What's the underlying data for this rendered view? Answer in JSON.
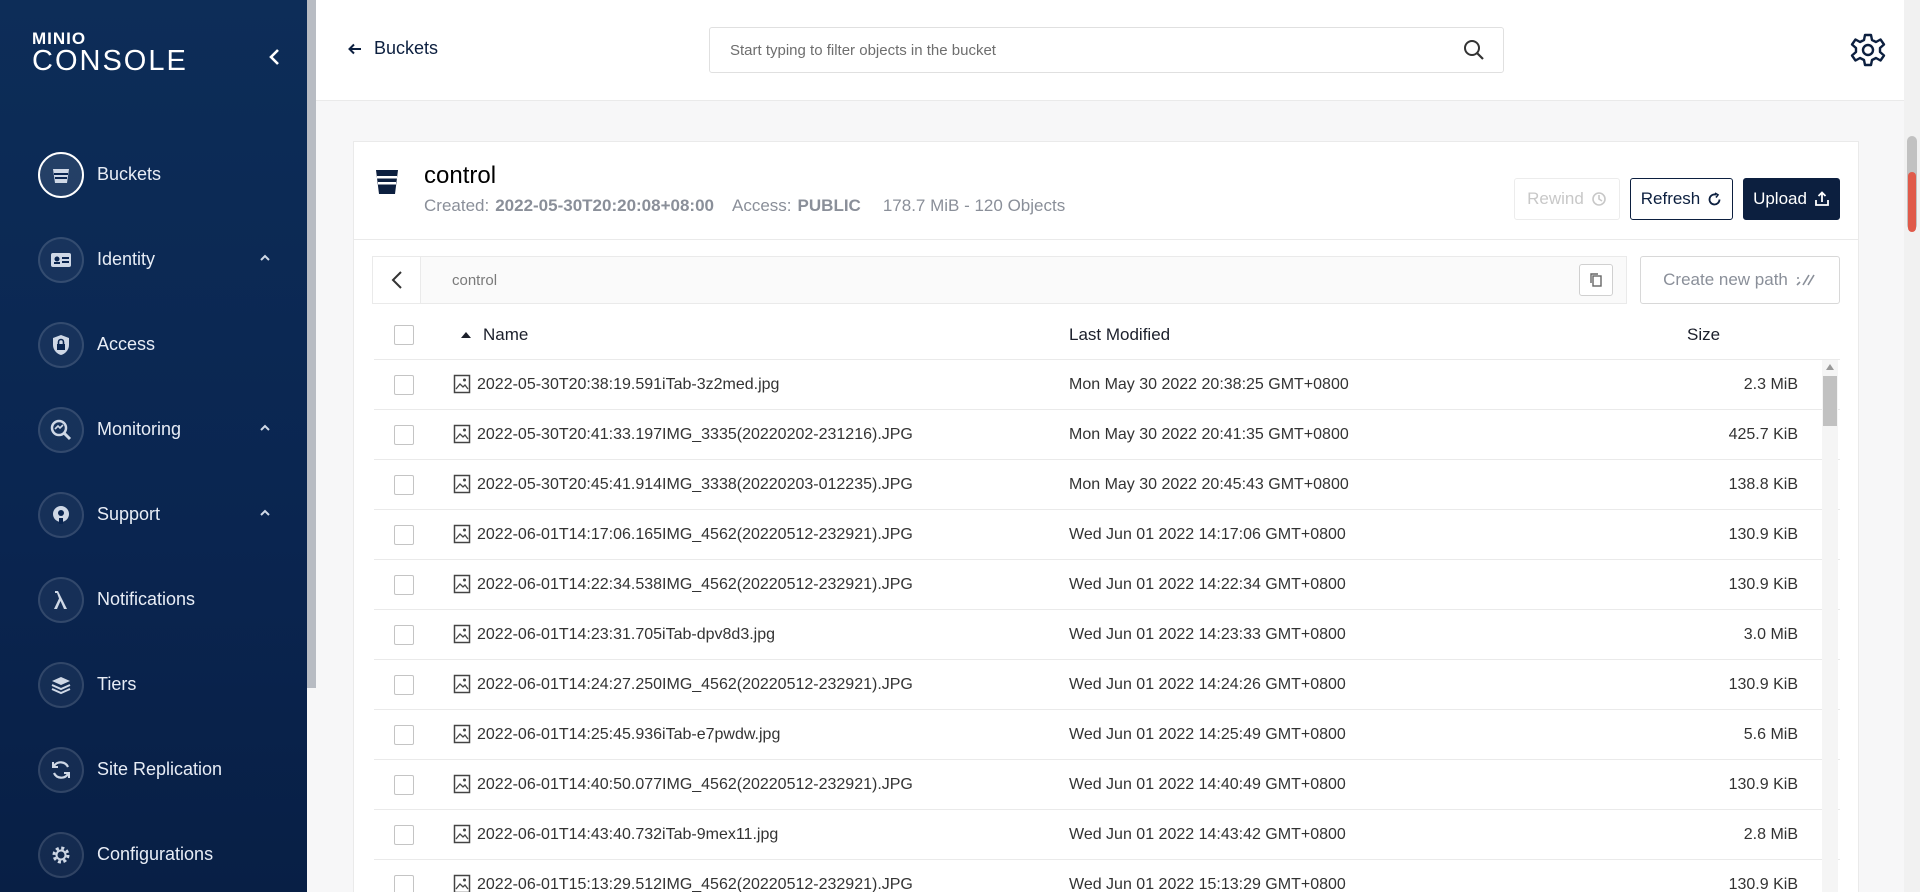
{
  "sidebar": {
    "brand": "MINIO",
    "product": "CONSOLE",
    "items": [
      {
        "label": "Buckets",
        "icon": "bucket-icon",
        "active": true
      },
      {
        "label": "Identity",
        "icon": "id-card-icon",
        "expandable": true
      },
      {
        "label": "Access",
        "icon": "lock-shield-icon"
      },
      {
        "label": "Monitoring",
        "icon": "magnifier-chart-icon",
        "expandable": true
      },
      {
        "label": "Support",
        "icon": "support-icon",
        "expandable": true
      },
      {
        "label": "Notifications",
        "icon": "lambda-icon"
      },
      {
        "label": "Tiers",
        "icon": "layers-icon"
      },
      {
        "label": "Site Replication",
        "icon": "sync-icon"
      },
      {
        "label": "Configurations",
        "icon": "gear-icon"
      }
    ]
  },
  "header": {
    "back_label": "Buckets",
    "search_placeholder": "Start typing to filter objects in the bucket"
  },
  "bucket": {
    "name": "control",
    "created_label": "Created:",
    "created_value": "2022-05-30T20:20:08+08:00",
    "access_label": "Access:",
    "access_value": "PUBLIC",
    "size_summary": "178.7 MiB - 120 Objects",
    "rewind_label": "Rewind",
    "refresh_label": "Refresh",
    "upload_label": "Upload"
  },
  "breadcrumb": {
    "path": "control",
    "new_path_label": "Create new path"
  },
  "table": {
    "columns": {
      "name": "Name",
      "modified": "Last Modified",
      "size": "Size"
    },
    "rows": [
      {
        "name": "2022-05-30T20:38:19.591iTab-3z2med.jpg",
        "modified": "Mon May 30 2022 20:38:25 GMT+0800",
        "size": "2.3 MiB"
      },
      {
        "name": "2022-05-30T20:41:33.197IMG_3335(20220202-231216).JPG",
        "modified": "Mon May 30 2022 20:41:35 GMT+0800",
        "size": "425.7 KiB"
      },
      {
        "name": "2022-05-30T20:45:41.914IMG_3338(20220203-012235).JPG",
        "modified": "Mon May 30 2022 20:45:43 GMT+0800",
        "size": "138.8 KiB"
      },
      {
        "name": "2022-06-01T14:17:06.165IMG_4562(20220512-232921).JPG",
        "modified": "Wed Jun 01 2022 14:17:06 GMT+0800",
        "size": "130.9 KiB"
      },
      {
        "name": "2022-06-01T14:22:34.538IMG_4562(20220512-232921).JPG",
        "modified": "Wed Jun 01 2022 14:22:34 GMT+0800",
        "size": "130.9 KiB"
      },
      {
        "name": "2022-06-01T14:23:31.705iTab-dpv8d3.jpg",
        "modified": "Wed Jun 01 2022 14:23:33 GMT+0800",
        "size": "3.0 MiB"
      },
      {
        "name": "2022-06-01T14:24:27.250IMG_4562(20220512-232921).JPG",
        "modified": "Wed Jun 01 2022 14:24:26 GMT+0800",
        "size": "130.9 KiB"
      },
      {
        "name": "2022-06-01T14:25:45.936iTab-e7pwdw.jpg",
        "modified": "Wed Jun 01 2022 14:25:49 GMT+0800",
        "size": "5.6 MiB"
      },
      {
        "name": "2022-06-01T14:40:50.077IMG_4562(20220512-232921).JPG",
        "modified": "Wed Jun 01 2022 14:40:49 GMT+0800",
        "size": "130.9 KiB"
      },
      {
        "name": "2022-06-01T14:43:40.732iTab-9mex11.jpg",
        "modified": "Wed Jun 01 2022 14:43:42 GMT+0800",
        "size": "2.8 MiB"
      },
      {
        "name": "2022-06-01T15:13:29.512IMG_4562(20220512-232921).JPG",
        "modified": "Wed Jun 01 2022 15:13:29 GMT+0800",
        "size": "130.9 KiB"
      }
    ]
  },
  "colors": {
    "sidebar": "#0a2550",
    "accent": "#0c1f3f"
  }
}
